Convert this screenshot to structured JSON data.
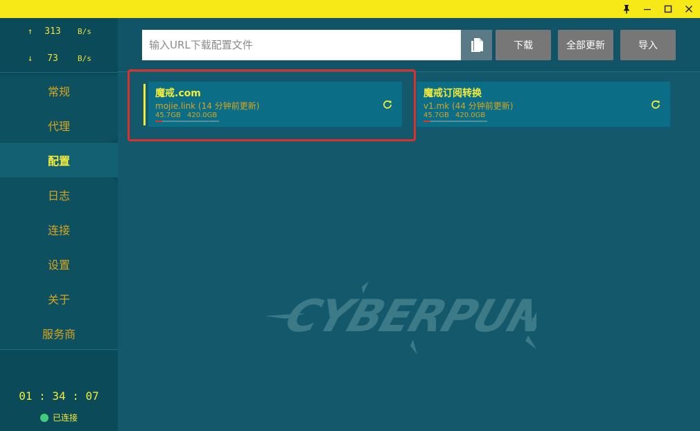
{
  "window": {
    "controls": {
      "pin": "pin-icon",
      "minimize": "minimize-icon",
      "maximize": "maximize-icon",
      "close": "close-icon"
    }
  },
  "traffic": {
    "upload": {
      "arrow": "↑",
      "value": "313",
      "unit": "B/s"
    },
    "download": {
      "arrow": "↓",
      "value": "73",
      "unit": "B/s"
    }
  },
  "nav": {
    "items": [
      {
        "label": "常规",
        "active": false
      },
      {
        "label": "代理",
        "active": false
      },
      {
        "label": "配置",
        "active": true
      },
      {
        "label": "日志",
        "active": false
      },
      {
        "label": "连接",
        "active": false
      },
      {
        "label": "设置",
        "active": false
      },
      {
        "label": "关于",
        "active": false
      },
      {
        "label": "服务商",
        "active": false
      }
    ]
  },
  "footer": {
    "time": "01 : 34 : 07",
    "status": "已连接"
  },
  "toolbar": {
    "url_placeholder": "输入URL下载配置文件",
    "download_label": "下载",
    "update_all_label": "全部更新",
    "import_label": "导入"
  },
  "profiles": [
    {
      "name": "魔戒.com",
      "info": "mojie.link (14 分钟前更新)",
      "used": "45.7GB",
      "total": "420.0GB",
      "usage_fraction": 0.11,
      "selected": true
    },
    {
      "name": "魔戒订阅转换",
      "info": "v1.mk (44 分钟前更新)",
      "used": "45.7GB",
      "total": "420.0GB",
      "usage_fraction": 0.11,
      "selected": false
    }
  ],
  "background_logo": "CYBERPUNK",
  "colors": {
    "accent": "#f3ec3a",
    "text_gold": "#d7a522",
    "highlight": "#e02f2a",
    "titlebar": "#f7e818"
  }
}
